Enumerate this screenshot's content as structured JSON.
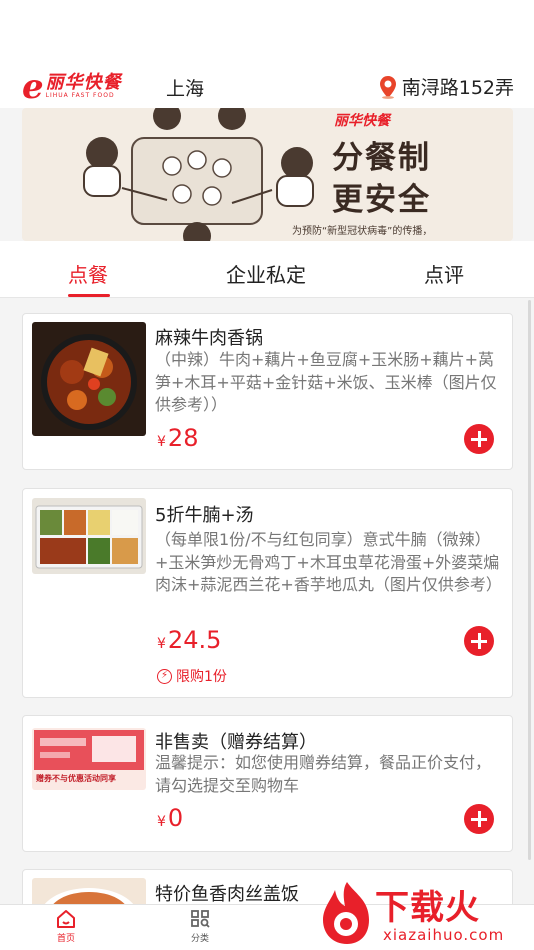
{
  "header": {
    "logo_letter": "e",
    "logo_cn": "丽华快餐",
    "logo_en": "LIHUA FAST FOOD",
    "city": "上海",
    "address": "南浔路152弄"
  },
  "banner": {
    "brand": "丽华快餐",
    "headline_1": "分餐制",
    "headline_2": "更安全",
    "note": "为预防“新型冠状病毒”的传播，"
  },
  "tabs": [
    {
      "label": "点餐",
      "active": true
    },
    {
      "label": "企业私定",
      "active": false
    },
    {
      "label": "点评",
      "active": false
    }
  ],
  "items": [
    {
      "name": "麻辣牛肉香锅",
      "desc": "（中辣）牛肉+藕片+鱼豆腐+玉米肠+藕片+莴笋+木耳+平菇+金针菇+米饭、玉米棒（图片仅供参考））",
      "currency": "¥",
      "price": "28"
    },
    {
      "name": "5折牛腩+汤",
      "desc": "（每单限1份/不与红包同享）意式牛腩（微辣）+玉米笋炒无骨鸡丁+木耳虫草花滑蛋+外婆菜煸肉沫+蒜泥西兰花+香芋地瓜丸（图片仅供参考）",
      "currency": "¥",
      "price": "24.5",
      "limit": "限购1份"
    },
    {
      "name": "非售卖（赠券结算）",
      "desc": "温馨提示：如您使用赠券结算，餐品正价支付，请勾选提交至购物车",
      "currency": "¥",
      "price": "0",
      "thumb_text": "赠券不与优惠活动同享"
    },
    {
      "name": "特价鱼香肉丝盖饭"
    }
  ],
  "bottom_nav": [
    {
      "label": "首页",
      "icon": "home-icon",
      "active": true
    },
    {
      "label": "分类",
      "icon": "category-icon",
      "active": false
    }
  ],
  "watermark": {
    "text": "下载火",
    "url": "xiazaihuo.com"
  },
  "colors": {
    "accent": "#e8202a",
    "text": "#222222",
    "muted": "#777777",
    "background": "#f4f4f4"
  }
}
